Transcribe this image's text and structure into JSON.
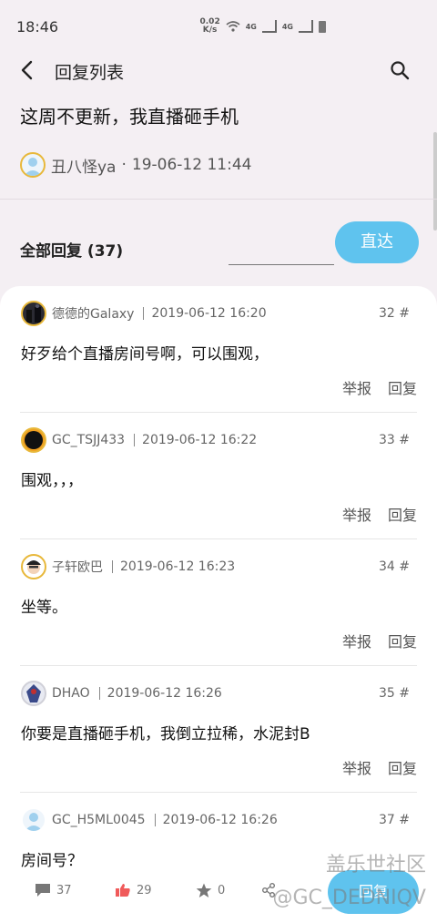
{
  "status": {
    "time": "18:46",
    "speed": "0.02",
    "speed_unit": "K/s",
    "net1": "4G",
    "net2": "4G"
  },
  "topbar": {
    "title": "回复列表"
  },
  "post": {
    "title": "这周不更新，我直播砸手机",
    "author": "丑八怪ya",
    "date_sep": "·",
    "date": "19-06-12 11:44"
  },
  "replies_header": {
    "label": "全部回复 (37)"
  },
  "jump": {
    "input_value": "",
    "button_label": "直达"
  },
  "replies": [
    {
      "name": "德德的Galaxy",
      "time": "2019-06-12 16:20",
      "floor": "32 #",
      "content": "好歹给个直播房间号啊，可以围观，",
      "report": "举报",
      "reply": "回复"
    },
    {
      "name": "GC_TSJJ433",
      "time": "2019-06-12 16:22",
      "floor": "33 #",
      "content": "围观，，，",
      "report": "举报",
      "reply": "回复"
    },
    {
      "name": "子轩欧巴",
      "time": "2019-06-12 16:23",
      "floor": "34 #",
      "content": "坐等。",
      "report": "举报",
      "reply": "回复"
    },
    {
      "name": "DHAO",
      "time": "2019-06-12 16:26",
      "floor": "35 #",
      "content": "你要是直播砸手机，我倒立拉稀，水泥封B",
      "report": "举报",
      "reply": "回复"
    },
    {
      "name": "GC_H5ML0045",
      "time": "2019-06-12 16:26",
      "floor": "37 #",
      "content": "房间号？",
      "report": "",
      "reply": ""
    }
  ],
  "bottom": {
    "comments": "37",
    "likes": "29",
    "favorites": "0",
    "fab_label": "回复"
  },
  "watermark": {
    "line1": "盖乐世社区",
    "line2": "@GC_DEDNIQV"
  },
  "colors": {
    "accent": "#5fc3ee",
    "avatar_border": "#e8b83a",
    "background": "#f4eff3"
  }
}
